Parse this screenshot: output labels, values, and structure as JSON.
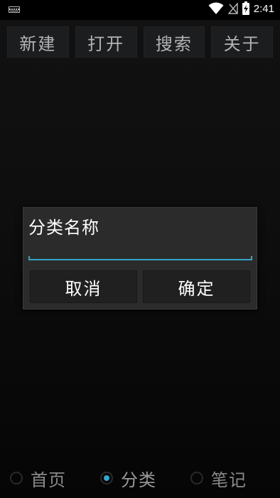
{
  "status_bar": {
    "time": "2:41",
    "icons": [
      "keyboard-icon",
      "wifi-icon",
      "no-signal-icon",
      "battery-charging-icon"
    ]
  },
  "toolbar": {
    "new_label": "新建",
    "open_label": "打开",
    "search_label": "搜索",
    "about_label": "关于"
  },
  "dialog": {
    "title": "分类名称",
    "input_value": "",
    "cancel_label": "取消",
    "ok_label": "确定"
  },
  "bottom_nav": {
    "items": [
      {
        "label": "首页",
        "checked": false
      },
      {
        "label": "分类",
        "checked": true
      },
      {
        "label": "笔记",
        "checked": false
      }
    ]
  },
  "colors": {
    "accent": "#34a6c9",
    "background": "#0d0d0d",
    "dialog_bg": "#2b2b2b"
  }
}
